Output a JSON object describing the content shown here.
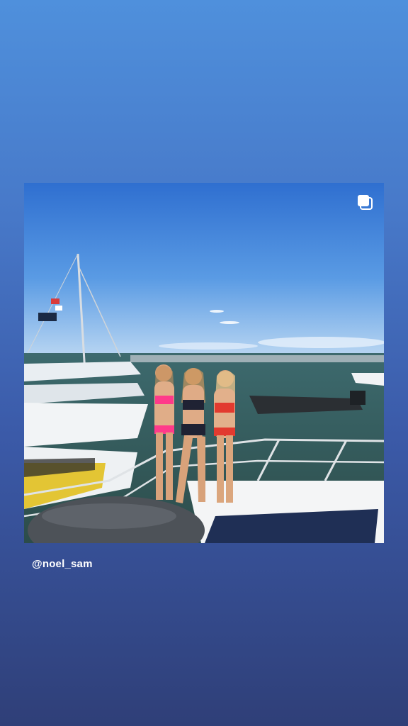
{
  "post": {
    "username": "@noel_sam",
    "icon": "carousel-icon",
    "image_description_icon": "photo"
  },
  "colors": {
    "background_top": "#4f90dc",
    "background_bottom": "#2f3f78",
    "text": "#ffffff"
  }
}
